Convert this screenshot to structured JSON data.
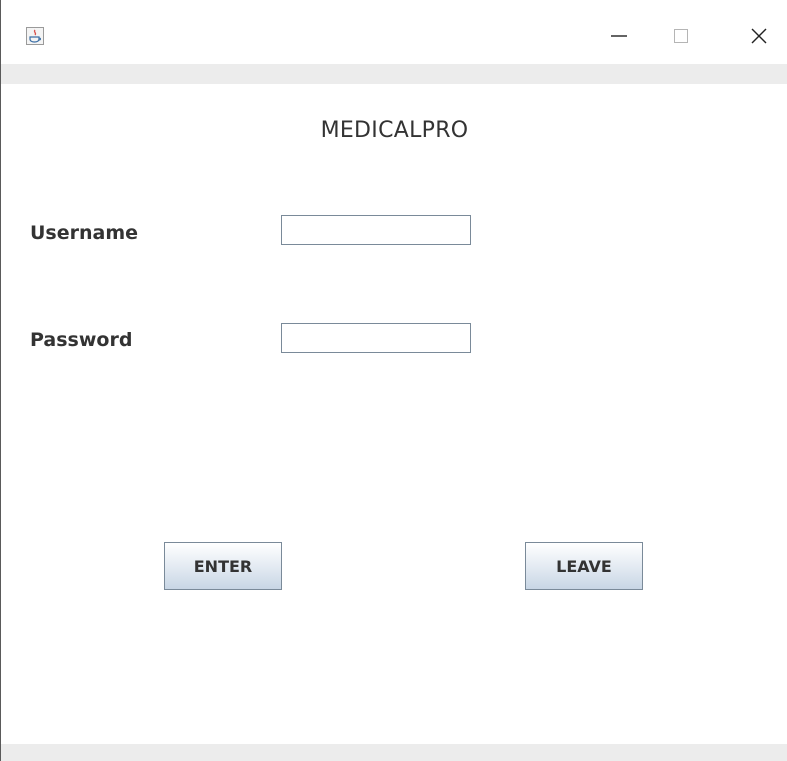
{
  "window": {
    "controls": {
      "minimize_icon": "minimize-icon",
      "maximize_icon": "maximize-icon",
      "close_icon": "close-icon"
    },
    "app_icon": "java-icon"
  },
  "form": {
    "title": "MEDICALPRO",
    "username_label": "Username",
    "username_value": "",
    "password_label": "Password",
    "password_value": ""
  },
  "buttons": {
    "enter_label": "ENTER",
    "leave_label": "LEAVE"
  },
  "colors": {
    "text": "#333333",
    "button_gradient_end": "#c8d6e5",
    "strip": "#ececec"
  }
}
